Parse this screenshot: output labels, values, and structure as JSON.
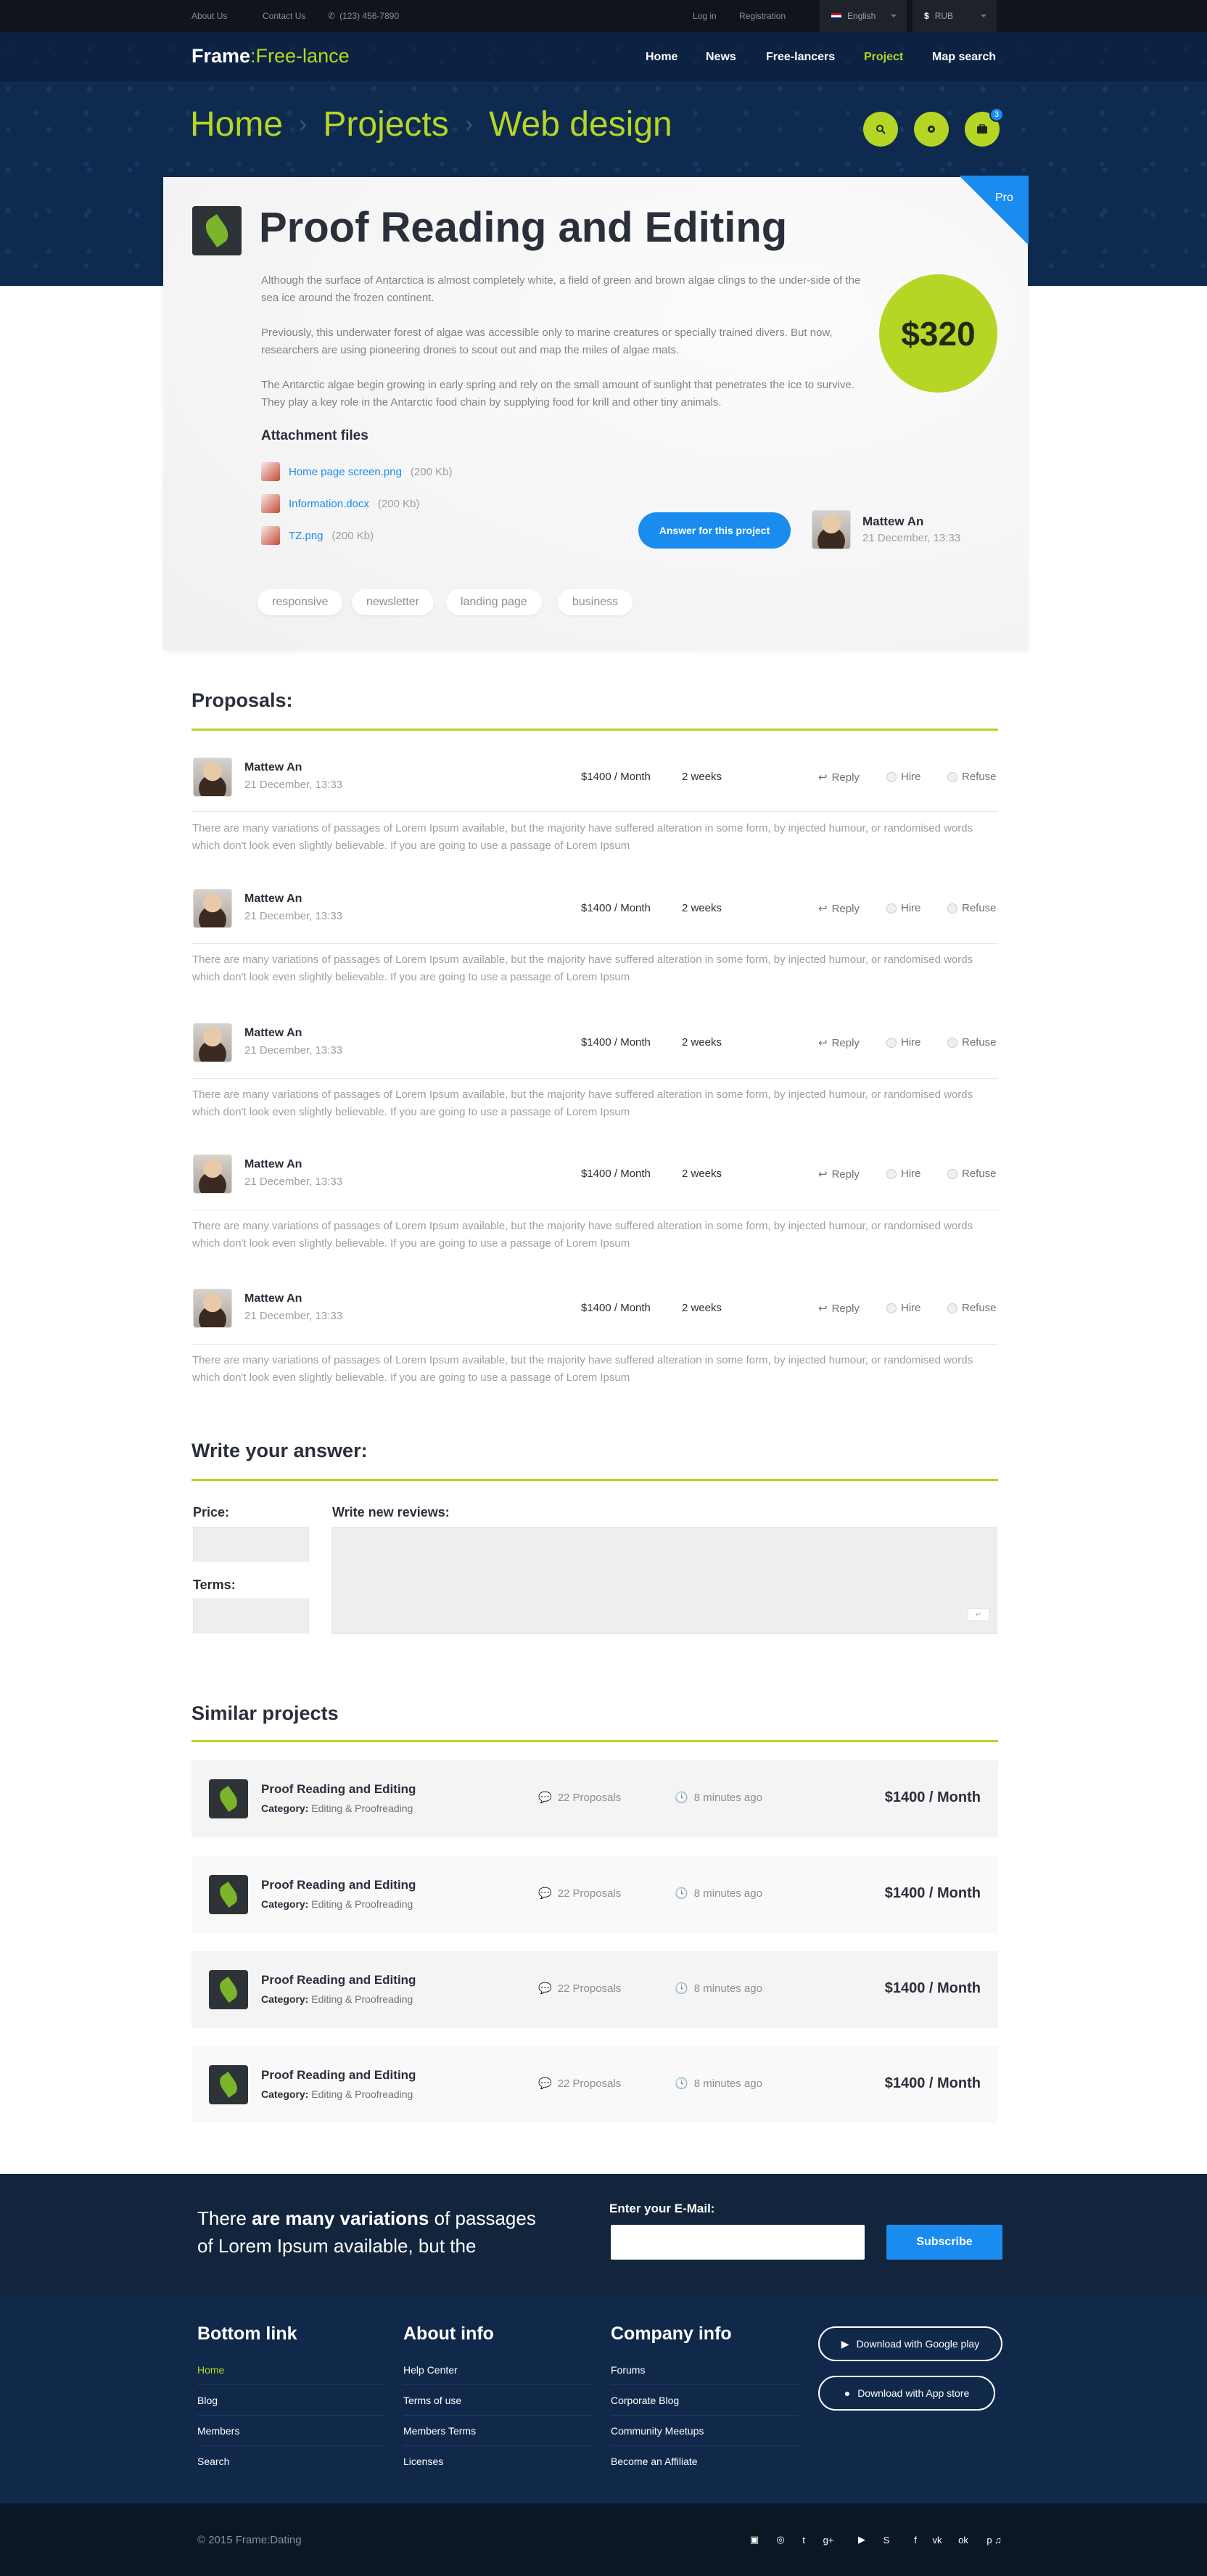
{
  "topbar": {
    "about": "About Us",
    "contact": "Contact Us",
    "phone": "(123) 456-7890",
    "login": "Log in",
    "register": "Registration",
    "language": "English",
    "currency_symbol": "$",
    "currency": "RUB"
  },
  "header": {
    "logo_main": "Frame",
    "logo_sub": ":Free-lance",
    "nav": [
      "Home",
      "News",
      "Free-lancers",
      "Project",
      "Map search"
    ],
    "breadcrumb": [
      "Home",
      "Projects",
      "Web design"
    ],
    "notifications_count": "3"
  },
  "project": {
    "badge": "Pro",
    "title": "Proof Reading and Editing",
    "price": "$320",
    "paragraphs": [
      "Although the surface of Antarctica is almost completely white, a field of green and brown algae clings to the under-side of the sea ice around the frozen continent.",
      "Previously, this underwater forest of algae was accessible only to marine creatures or specially trained divers. But now, researchers are using pioneering drones to scout out and map the miles of algae mats.",
      "The Antarctic algae begin growing in early spring and rely on the small amount of sunlight that penetrates the ice to survive. They play a key role in the Antarctic food chain by supplying food for krill and other tiny animals."
    ],
    "attachments_title": "Attachment files",
    "attachments": [
      {
        "name": "Home page screen.png",
        "size": "(200 Kb)"
      },
      {
        "name": "Information.docx",
        "size": "(200 Kb)"
      },
      {
        "name": "TZ.png",
        "size": "(200 Kb)"
      }
    ],
    "answer_button": "Answer for this project",
    "author": {
      "name": "Mattew An",
      "date": "21 December, 13:33"
    },
    "tags": [
      "responsive",
      "newsletter",
      "landing page",
      "business"
    ]
  },
  "proposals": {
    "title": "Proposals:",
    "actions": {
      "reply": "Reply",
      "hire": "Hire",
      "refuse": "Refuse"
    },
    "items": [
      {
        "name": "Mattew An",
        "date": "21 December, 13:33",
        "rate": "$1400 / Month",
        "duration": "2 weeks",
        "text": "There are many variations of passages of Lorem Ipsum available, but the majority have suffered alteration in some form, by injected humour, or randomised words which don't look even slightly believable. If you are going to use a passage of Lorem Ipsum"
      },
      {
        "name": "Mattew An",
        "date": "21 December, 13:33",
        "rate": "$1400 / Month",
        "duration": "2 weeks",
        "text": "There are many variations of passages of Lorem Ipsum available, but the majority have suffered alteration in some form, by injected humour, or randomised words which don't look even slightly believable. If you are going to use a passage of Lorem Ipsum"
      },
      {
        "name": "Mattew An",
        "date": "21 December, 13:33",
        "rate": "$1400 / Month",
        "duration": "2 weeks",
        "text": "There are many variations of passages of Lorem Ipsum available, but the majority have suffered alteration in some form, by injected humour, or randomised words which don't look even slightly believable. If you are going to use a passage of Lorem Ipsum"
      },
      {
        "name": "Mattew An",
        "date": "21 December, 13:33",
        "rate": "$1400 / Month",
        "duration": "2 weeks",
        "text": "There are many variations of passages of Lorem Ipsum available, but the majority have suffered alteration in some form, by injected humour, or randomised words which don't look even slightly believable. If you are going to use a passage of Lorem Ipsum"
      },
      {
        "name": "Mattew An",
        "date": "21 December, 13:33",
        "rate": "$1400 / Month",
        "duration": "2 weeks",
        "text": "There are many variations of passages of Lorem Ipsum available, but the majority have suffered alteration in some form, by injected humour, or randomised words which don't look even slightly believable. If you are going to use a passage of Lorem Ipsum"
      }
    ]
  },
  "answer_form": {
    "title": "Write your answer:",
    "price_label": "Price:",
    "terms_label": "Terms:",
    "review_label": "Write new reviews:",
    "price_value": "",
    "terms_value": "",
    "review_placeholder": ""
  },
  "similar": {
    "title": "Similar projects",
    "category_label": "Category:",
    "items": [
      {
        "title": "Proof Reading and Editing",
        "category": "Editing & Proofreading",
        "proposals": "22 Proposals",
        "time": "8 minutes ago",
        "price": "$1400 / Month"
      },
      {
        "title": "Proof Reading and Editing",
        "category": "Editing & Proofreading",
        "proposals": "22 Proposals",
        "time": "8 minutes ago",
        "price": "$1400 / Month"
      },
      {
        "title": "Proof Reading and Editing",
        "category": "Editing & Proofreading",
        "proposals": "22 Proposals",
        "time": "8 minutes ago",
        "price": "$1400 / Month"
      },
      {
        "title": "Proof Reading and Editing",
        "category": "Editing & Proofreading",
        "proposals": "22 Proposals",
        "time": "8 minutes ago",
        "price": "$1400 / Month"
      }
    ]
  },
  "newsletter": {
    "text_pre": "There ",
    "text_bold": "are many variations",
    "text_post": " of passages of Lorem Ipsum available, but the",
    "email_label": "Enter your E-Mail:",
    "email_value": "",
    "subscribe": "Subscribe"
  },
  "footer": {
    "col1": {
      "title": "Bottom link",
      "links": [
        "Home",
        "Blog",
        "Members",
        "Search"
      ]
    },
    "col2": {
      "title": "About info",
      "links": [
        "Help Center",
        "Terms of use",
        "Members Terms",
        "Licenses"
      ]
    },
    "col3": {
      "title": "Company info",
      "links": [
        "Forums",
        "Corporate Blog",
        "Community Meetups",
        "Become an Affiliate"
      ]
    },
    "google_play": "Download with Google play",
    "app_store": "Download with App store",
    "copyright": "© 2015 Frame:Dating"
  },
  "colors": {
    "accent": "#b5d624",
    "primary": "#1a8cf0",
    "navy": "#0f2a4f"
  }
}
